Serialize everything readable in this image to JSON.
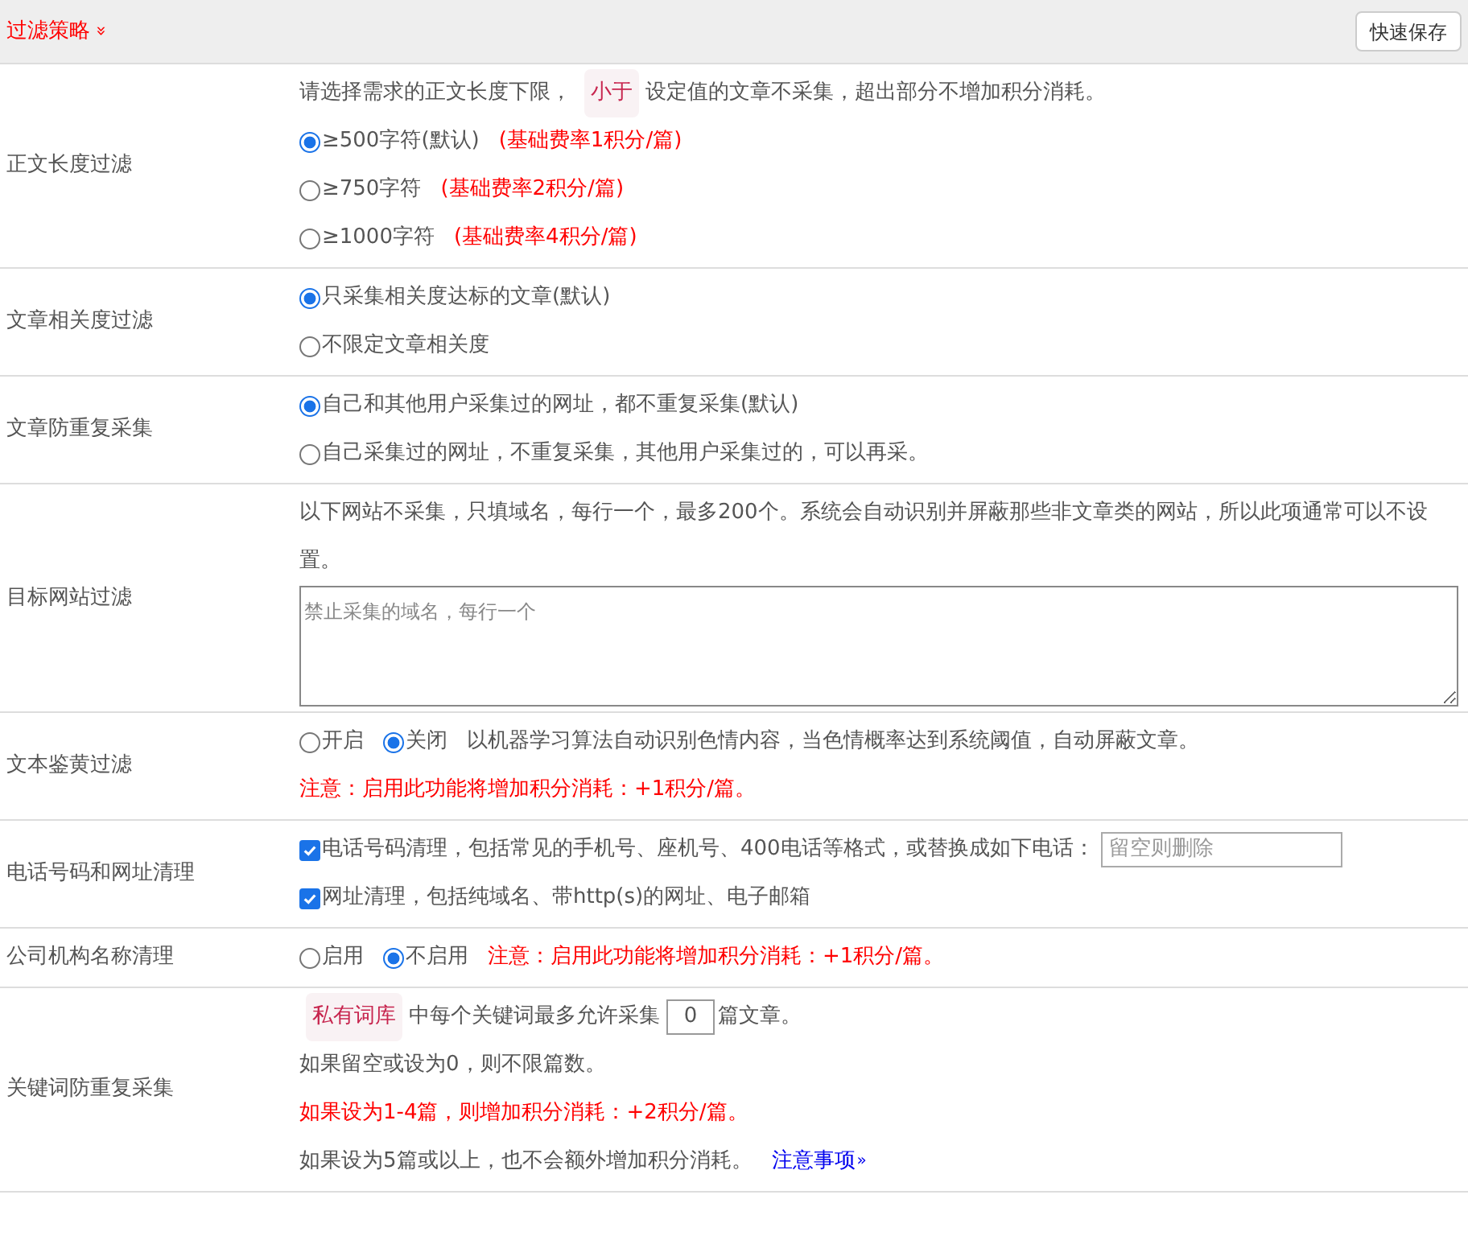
{
  "header": {
    "title": "过滤策略",
    "chevron": "»",
    "save_button": "快速保存"
  },
  "rows": [
    {
      "label": "正文长度过滤",
      "lines": [
        {
          "parts": [
            {
              "kind": "text",
              "text": "请选择需求的正文长度下限，"
            },
            {
              "kind": "tag",
              "text": "小于"
            },
            {
              "kind": "text",
              "text": "设定值的文章不采集，超出部分不增加积分消耗。"
            }
          ]
        },
        {
          "parts": [
            {
              "kind": "radio",
              "label": "≥500字符(默认)",
              "selected": true
            },
            {
              "kind": "note",
              "text": "(基础费率1积分/篇)"
            }
          ]
        },
        {
          "parts": [
            {
              "kind": "radio",
              "label": "≥750字符",
              "selected": false
            },
            {
              "kind": "note",
              "text": "(基础费率2积分/篇)"
            }
          ]
        },
        {
          "parts": [
            {
              "kind": "radio",
              "label": "≥1000字符",
              "selected": false
            },
            {
              "kind": "note",
              "text": "(基础费率4积分/篇)"
            }
          ]
        }
      ]
    },
    {
      "label": "文章相关度过滤",
      "lines": [
        {
          "parts": [
            {
              "kind": "radio",
              "label": "只采集相关度达标的文章(默认)",
              "selected": true
            }
          ]
        },
        {
          "parts": [
            {
              "kind": "radio",
              "label": "不限定文章相关度",
              "selected": false
            }
          ]
        }
      ]
    },
    {
      "label": "文章防重复采集",
      "lines": [
        {
          "parts": [
            {
              "kind": "radio",
              "label": "自己和其他用户采集过的网址，都不重复采集(默认)",
              "selected": true
            }
          ]
        },
        {
          "parts": [
            {
              "kind": "radio",
              "label": "自己采集过的网址，不重复采集，其他用户采集过的，可以再采。",
              "selected": false
            }
          ]
        }
      ]
    },
    {
      "label": "目标网站过滤",
      "lines": [
        {
          "parts": [
            {
              "kind": "text",
              "text": "以下网站不采集，只填域名，每行一个，最多200个。系统会自动识别并屏蔽那些非文章类的网站，所以此项通常可以不设置。"
            }
          ]
        },
        {
          "parts": [
            {
              "kind": "textarea",
              "placeholder": "禁止采集的域名，每行一个"
            }
          ]
        }
      ]
    },
    {
      "label": "文本鉴黄过滤",
      "lines": [
        {
          "parts": [
            {
              "kind": "radio",
              "label": "开启",
              "selected": false
            },
            {
              "kind": "radio",
              "label": "关闭",
              "selected": true
            },
            {
              "kind": "text",
              "text": "以机器学习算法自动识别色情内容，当色情概率达到系统阈值，自动屏蔽文章。"
            }
          ]
        },
        {
          "parts": [
            {
              "kind": "note",
              "text": "注意：启用此功能将增加积分消耗：+1积分/篇。"
            }
          ]
        }
      ]
    },
    {
      "label": "电话号码和网址清理",
      "lines": [
        {
          "parts": [
            {
              "kind": "checkbox",
              "label": "电话号码清理，包括常见的手机号、座机号、400电话等格式，或替换成如下电话：",
              "checked": true
            },
            {
              "kind": "input",
              "placeholder": "留空则删除"
            }
          ]
        },
        {
          "parts": [
            {
              "kind": "checkbox",
              "label": "网址清理，包括纯域名、带http(s)的网址、电子邮箱",
              "checked": true
            }
          ]
        }
      ]
    },
    {
      "label": "公司机构名称清理",
      "lines": [
        {
          "parts": [
            {
              "kind": "radio",
              "label": "启用",
              "selected": false
            },
            {
              "kind": "radio",
              "label": "不启用",
              "selected": true
            },
            {
              "kind": "note",
              "text": "注意：启用此功能将增加积分消耗：+1积分/篇。"
            }
          ]
        }
      ]
    },
    {
      "label": "关键词防重复采集",
      "lines": [
        {
          "parts": [
            {
              "kind": "tag",
              "text": "私有词库"
            },
            {
              "kind": "text",
              "text": "中每个关键词最多允许采集"
            },
            {
              "kind": "number",
              "value": "0"
            },
            {
              "kind": "text",
              "text": "篇文章。"
            }
          ]
        },
        {
          "parts": [
            {
              "kind": "text",
              "text": "如果留空或设为0，则不限篇数。"
            }
          ]
        },
        {
          "parts": [
            {
              "kind": "note",
              "text": "如果设为1-4篇，则增加积分消耗：+2积分/篇。"
            }
          ]
        },
        {
          "parts": [
            {
              "kind": "text",
              "text": "如果设为5篇或以上，也不会额外增加积分消耗。"
            },
            {
              "kind": "link",
              "text": "注意事项",
              "chevron": "»"
            }
          ]
        }
      ]
    }
  ]
}
